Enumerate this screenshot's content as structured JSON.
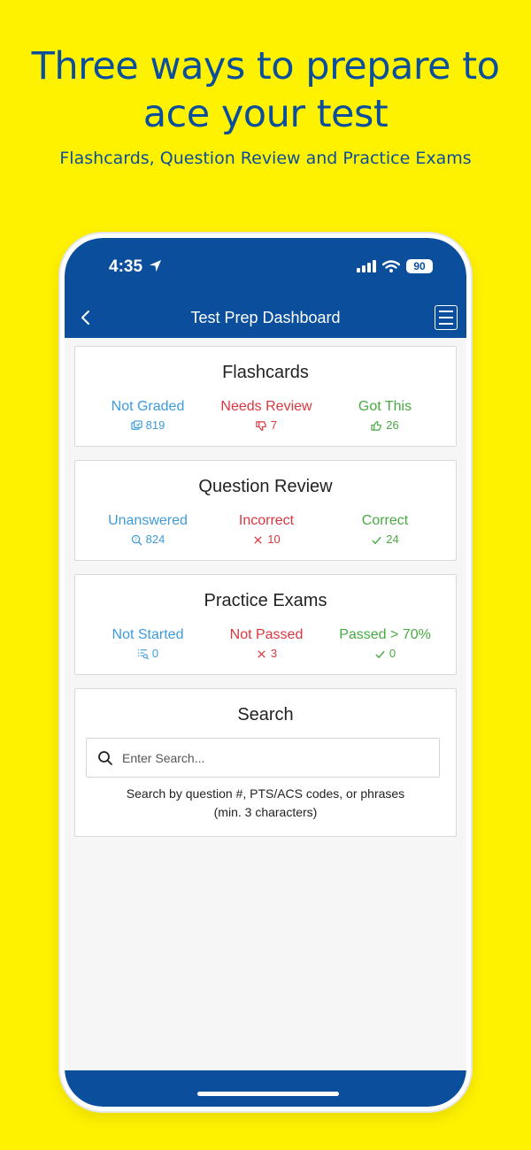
{
  "promo": {
    "title_line1": "Three ways to prepare to",
    "title_line2": "ace your test",
    "subtitle": "Flashcards, Question Review and Practice Exams"
  },
  "status_bar": {
    "time": "4:35",
    "battery": "90"
  },
  "nav": {
    "title": "Test Prep Dashboard"
  },
  "flashcards": {
    "title": "Flashcards",
    "stats": [
      {
        "label": "Not Graded",
        "count": "819",
        "icon": "cards-icon"
      },
      {
        "label": "Needs Review",
        "count": "7",
        "icon": "thumbs-down-icon"
      },
      {
        "label": "Got This",
        "count": "26",
        "icon": "thumbs-up-icon"
      }
    ]
  },
  "question_review": {
    "title": "Question Review",
    "stats": [
      {
        "label": "Unanswered",
        "count": "824",
        "icon": "question-search-icon"
      },
      {
        "label": "Incorrect",
        "count": "10",
        "icon": "x-icon"
      },
      {
        "label": "Correct",
        "count": "24",
        "icon": "check-icon"
      }
    ]
  },
  "practice_exams": {
    "title": "Practice Exams",
    "stats": [
      {
        "label": "Not Started",
        "count": "0",
        "icon": "list-search-icon"
      },
      {
        "label": "Not Passed",
        "count": "3",
        "icon": "x-icon"
      },
      {
        "label": "Passed > 70%",
        "count": "0",
        "icon": "check-icon"
      }
    ]
  },
  "search": {
    "title": "Search",
    "placeholder": "Enter Search...",
    "help_line1": "Search by question #, PTS/ACS codes, or phrases",
    "help_line2": "(min. 3 characters)"
  },
  "colors": {
    "background": "#FFF200",
    "brand": "#0B4F9C",
    "blue": "#3D9BDB",
    "red": "#D9363E",
    "green": "#49A942"
  }
}
